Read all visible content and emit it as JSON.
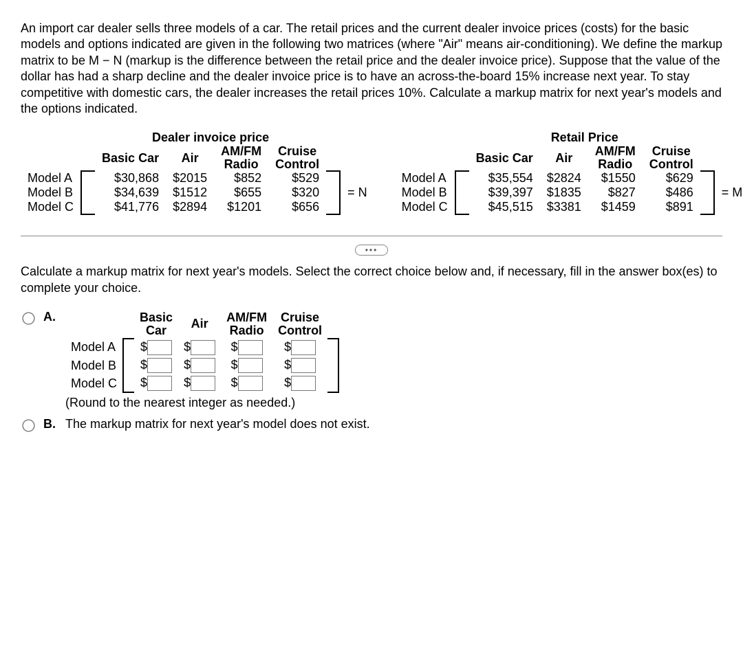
{
  "problem": "An import car dealer sells three models of a car. The retail prices and the current dealer invoice prices (costs) for the basic models and options indicated are given in the following two matrices (where \"Air\" means air-conditioning). We define the markup matrix to be M − N (markup is the difference between the retail price and the dealer invoice price). Suppose that the value of the dollar has had a sharp decline and the dealer invoice price is to have an across-the-board 15% increase next year. To stay competitive with domestic cars, the dealer increases the retail prices 10%. Calculate a markup matrix for next year's models and the options indicated.",
  "headers": {
    "basic": "Basic Car",
    "air": "Air",
    "amfm1": "AM/FM",
    "amfm2": "Radio",
    "cruise1": "Cruise",
    "cruise2": "Control"
  },
  "rowlabels": {
    "a": "Model A",
    "b": "Model B",
    "c": "Model C"
  },
  "matrixN": {
    "title": "Dealer invoice price",
    "rows": [
      {
        "basic": "$30,868",
        "air": "$2015",
        "amfm": "$852",
        "cruise": "$529"
      },
      {
        "basic": "$34,639",
        "air": "$1512",
        "amfm": "$655",
        "cruise": "$320"
      },
      {
        "basic": "$41,776",
        "air": "$2894",
        "amfm": "$1201",
        "cruise": "$656"
      }
    ],
    "eq": "= N"
  },
  "matrixM": {
    "title": "Retail Price",
    "rows": [
      {
        "basic": "$35,554",
        "air": "$2824",
        "amfm": "$1550",
        "cruise": "$629"
      },
      {
        "basic": "$39,397",
        "air": "$1835",
        "amfm": "$827",
        "cruise": "$486"
      },
      {
        "basic": "$45,515",
        "air": "$3381",
        "amfm": "$1459",
        "cruise": "$891"
      }
    ],
    "eq": "= M"
  },
  "dots": "•••",
  "question": "Calculate a markup matrix for next year's models. Select the correct choice below and, if necessary, fill in the answer box(es) to complete your choice.",
  "choiceA": {
    "label": "A.",
    "headers": {
      "basic1": "Basic",
      "basic2": "Car",
      "air": "Air",
      "amfm1": "AM/FM",
      "amfm2": "Radio",
      "cruise1": "Cruise",
      "cruise2": "Control"
    },
    "dollar": "$",
    "round": "(Round to the nearest integer as needed.)"
  },
  "choiceB": {
    "label": "B.",
    "text": "The markup matrix for next year's model does not exist."
  }
}
